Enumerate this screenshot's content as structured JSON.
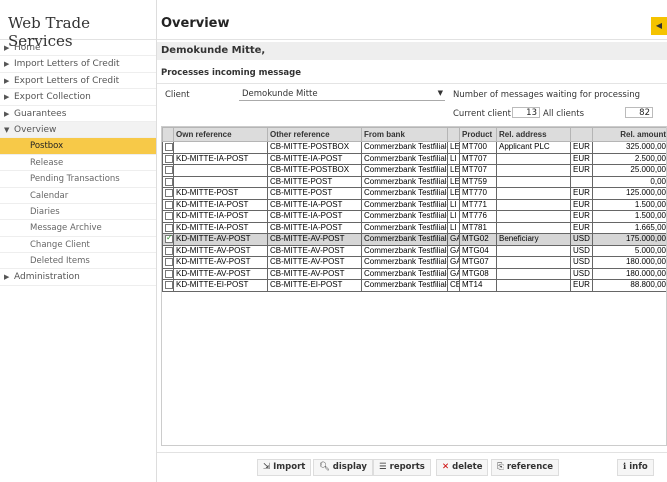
{
  "sidebar": {
    "brand": "Web Trade Services",
    "items": [
      {
        "label": "Home",
        "arrow": "▶"
      },
      {
        "label": "Import Letters of Credit",
        "arrow": "▶"
      },
      {
        "label": "Export Letters of Credit",
        "arrow": "▶"
      },
      {
        "label": "Export Collection",
        "arrow": "▶"
      },
      {
        "label": "Guarantees",
        "arrow": "▶"
      },
      {
        "label": "Overview",
        "arrow": "▼"
      },
      {
        "label": "Administration",
        "arrow": "▶"
      }
    ],
    "subitems": [
      "Postbox",
      "Release",
      "Pending Transactions",
      "Calendar",
      "Diaries",
      "Message Archive",
      "Change Client",
      "Deleted Items"
    ],
    "active_subitem": "Postbox"
  },
  "header": {
    "title": "Overview",
    "client_name": "Demokunde Mitte,",
    "section_title": "Processes incoming message"
  },
  "filter": {
    "client_label": "Client",
    "client_value": "Demokunde Mitte",
    "waiting_label": "Number of messages waiting for processing",
    "current_label": "Current client",
    "current_value": "13",
    "all_label": "All clients",
    "all_value": "82"
  },
  "table": {
    "columns": [
      "",
      "Own reference",
      "Other reference",
      "From bank",
      "",
      "Product ▲",
      "Rel. address",
      "",
      "Rel. amount"
    ],
    "rows": [
      {
        "checked": false,
        "own": "",
        "other": "CB-MITTE-POSTBOX",
        "bank": "Commerzbank Testfiliale",
        "type": "LE",
        "product": "MT700",
        "addr": "Applicant PLC",
        "cur": "EUR",
        "amount": "325.000,00"
      },
      {
        "checked": false,
        "own": "KD-MITTE-IA-POST",
        "other": "CB-MITTE-IA-POST",
        "bank": "Commerzbank Testfiliale",
        "type": "LI",
        "product": "MT707",
        "addr": "",
        "cur": "EUR",
        "amount": "2.500,00"
      },
      {
        "checked": false,
        "own": "",
        "other": "CB-MITTE-POSTBOX",
        "bank": "Commerzbank Testfiliale",
        "type": "LE",
        "product": "MT707",
        "addr": "",
        "cur": "EUR",
        "amount": "25.000,00"
      },
      {
        "checked": false,
        "own": "",
        "other": "CB-MITTE-POST",
        "bank": "Commerzbank Testfiliale",
        "type": "LE",
        "product": "MT759",
        "addr": "",
        "cur": "",
        "amount": "0,00"
      },
      {
        "checked": false,
        "own": "KD-MITTE-POST",
        "other": "CB-MITTE-POST",
        "bank": "Commerzbank Testfiliale",
        "type": "LE",
        "product": "MT770",
        "addr": "",
        "cur": "EUR",
        "amount": "125.000,00"
      },
      {
        "checked": false,
        "own": "KD-MITTE-IA-POST",
        "other": "CB-MITTE-IA-POST",
        "bank": "Commerzbank Testfiliale",
        "type": "LI",
        "product": "MT771",
        "addr": "",
        "cur": "EUR",
        "amount": "1.500,00"
      },
      {
        "checked": false,
        "own": "KD-MITTE-IA-POST",
        "other": "CB-MITTE-IA-POST",
        "bank": "Commerzbank Testfiliale",
        "type": "LI",
        "product": "MT776",
        "addr": "",
        "cur": "EUR",
        "amount": "1.500,00"
      },
      {
        "checked": false,
        "own": "KD-MITTE-IA-POST",
        "other": "CB-MITTE-IA-POST",
        "bank": "Commerzbank Testfiliale",
        "type": "LI",
        "product": "MT781",
        "addr": "",
        "cur": "EUR",
        "amount": "1.665,00"
      },
      {
        "checked": true,
        "own": "KD-MITTE-AV-POST",
        "other": "CB-MITTE-AV-POST",
        "bank": "Commerzbank Testfiliale",
        "type": "GA",
        "product": "MTG02",
        "addr": "Beneficiary",
        "cur": "USD",
        "amount": "175.000,00"
      },
      {
        "checked": false,
        "own": "KD-MITTE-AV-POST",
        "other": "CB-MITTE-AV-POST",
        "bank": "Commerzbank Testfiliale",
        "type": "GA",
        "product": "MTG04",
        "addr": "",
        "cur": "USD",
        "amount": "5.000,00"
      },
      {
        "checked": false,
        "own": "KD-MITTE-AV-POST",
        "other": "CB-MITTE-AV-POST",
        "bank": "Commerzbank Testfiliale",
        "type": "GA",
        "product": "MTG07",
        "addr": "",
        "cur": "USD",
        "amount": "180.000,00"
      },
      {
        "checked": false,
        "own": "KD-MITTE-AV-POST",
        "other": "CB-MITTE-AV-POST",
        "bank": "Commerzbank Testfiliale",
        "type": "GA",
        "product": "MTG08",
        "addr": "",
        "cur": "USD",
        "amount": "180.000,00"
      },
      {
        "checked": false,
        "own": "KD-MITTE-EI-POST",
        "other": "CB-MITTE-EI-POST",
        "bank": "Commerzbank Testfiliale",
        "type": "CE",
        "product": "MT14",
        "addr": "",
        "cur": "EUR",
        "amount": "88.800,00"
      }
    ]
  },
  "toolbar": {
    "import_label": "Import",
    "display_label": "display",
    "reports_label": "reports",
    "delete_label": "delete",
    "reference_label": "reference",
    "info_label": "info"
  },
  "colors": {
    "accent": "#f7c948",
    "collapse": "#f5c300",
    "delete": "#cc0000"
  }
}
